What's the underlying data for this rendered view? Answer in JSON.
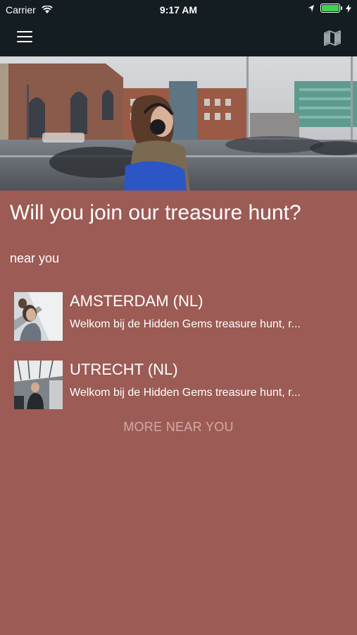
{
  "status_bar": {
    "carrier": "Carrier",
    "time": "9:17 AM",
    "battery_level": 1.0,
    "battery_color": "#3fd14f"
  },
  "nav": {
    "menu_icon": "hamburger-icon",
    "map_icon": "map-icon"
  },
  "hero": {
    "image": "woman-with-headphones-city-street"
  },
  "main": {
    "title": "Will you join our treasure hunt?",
    "section_label": "near you",
    "items": [
      {
        "name": "AMSTERDAM (NL)",
        "description": "Welkom bij de Hidden Gems treasure hunt, r..."
      },
      {
        "name": "UTRECHT (NL)",
        "description": "Welkom bij de Hidden Gems treasure hunt, r..."
      }
    ],
    "more_label": "MORE NEAR YOU"
  },
  "colors": {
    "background": "#9c5b55",
    "bar": "#141d22",
    "more_text": "#d6a9a5"
  }
}
